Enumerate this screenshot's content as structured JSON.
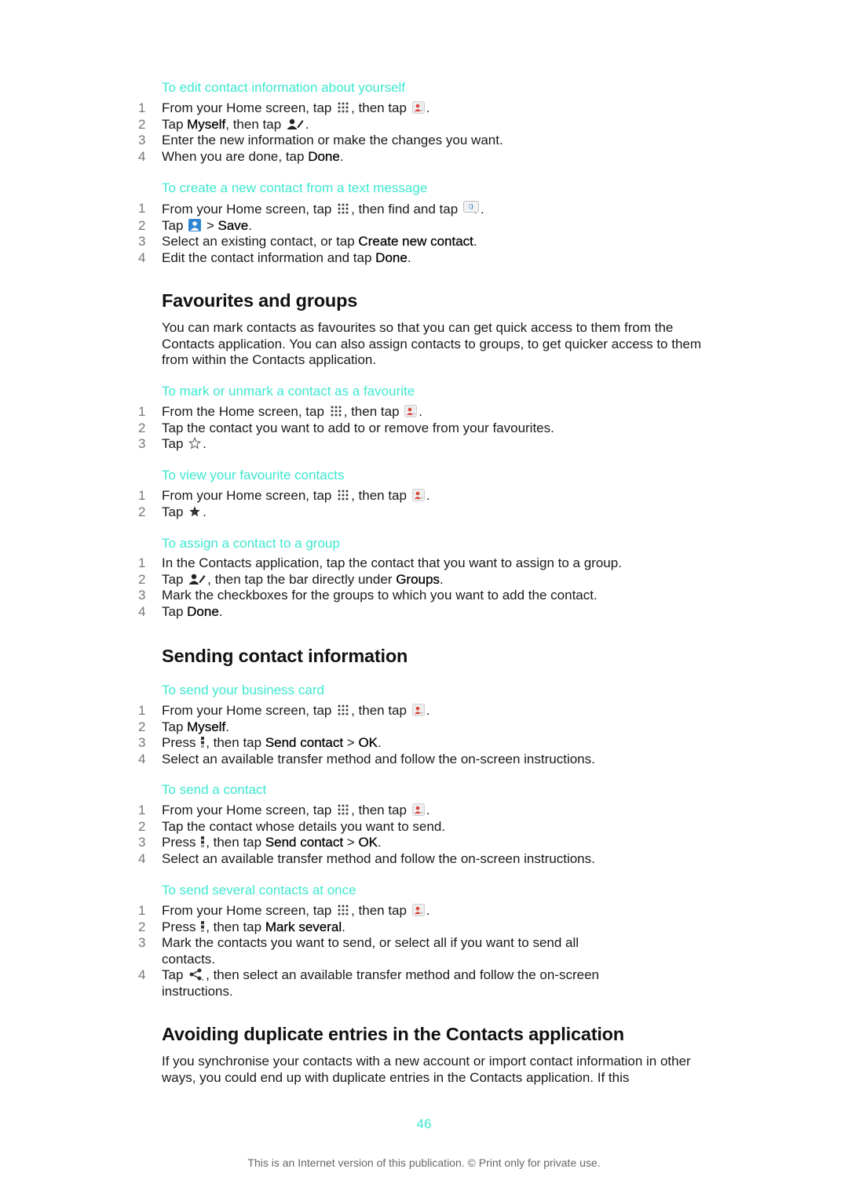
{
  "accent_color": "#3de8d0",
  "sections": {
    "edit_yourself": {
      "title": "To edit contact information about yourself",
      "steps": [
        {
          "n": "1",
          "a": "From your Home screen, tap ",
          "b": ", then tap ",
          "c": "."
        },
        {
          "n": "2",
          "a": "Tap ",
          "bold": "Myself",
          "b": ", then tap ",
          "c": "."
        },
        {
          "n": "3",
          "a": "Enter the new information or make the changes you want."
        },
        {
          "n": "4",
          "a": "When you are done, tap ",
          "bold": "Done",
          "c": "."
        }
      ]
    },
    "from_text": {
      "title": "To create a new contact from a text message",
      "steps": [
        {
          "n": "1",
          "a": "From your Home screen, tap ",
          "b": ", then find and tap ",
          "c": "."
        },
        {
          "n": "2",
          "a": "Tap ",
          "b": " > ",
          "bold": "Save",
          "c": "."
        },
        {
          "n": "3",
          "a": "Select an existing contact, or tap ",
          "bold": "Create new contact",
          "c": "."
        },
        {
          "n": "4",
          "a": "Edit the contact information and tap ",
          "bold": "Done",
          "c": "."
        }
      ]
    },
    "favourites": {
      "heading": "Favourites and groups",
      "intro": "You can mark contacts as favourites so that you can get quick access to them from the Contacts application. You can also assign contacts to groups, to get quicker access to them from within the Contacts application."
    },
    "mark_fav": {
      "title": "To mark or unmark a contact as a favourite",
      "steps": [
        {
          "n": "1",
          "a": "From the Home screen, tap ",
          "b": ", then tap ",
          "c": "."
        },
        {
          "n": "2",
          "a": "Tap the contact you want to add to or remove from your favourites."
        },
        {
          "n": "3",
          "a": "Tap ",
          "c": "."
        }
      ]
    },
    "view_fav": {
      "title": "To view your favourite contacts",
      "steps": [
        {
          "n": "1",
          "a": "From your Home screen, tap ",
          "b": ", then tap ",
          "c": "."
        },
        {
          "n": "2",
          "a": "Tap ",
          "c": "."
        }
      ]
    },
    "assign_group": {
      "title": "To assign a contact to a group",
      "steps": [
        {
          "n": "1",
          "a": "In the Contacts application, tap the contact that you want to assign to a group."
        },
        {
          "n": "2",
          "a": "Tap ",
          "b": ", then tap the bar directly under ",
          "bold": "Groups",
          "c": "."
        },
        {
          "n": "3",
          "a": "Mark the checkboxes for the groups to which you want to add the contact."
        },
        {
          "n": "4",
          "a": "Tap ",
          "bold": "Done",
          "c": "."
        }
      ]
    },
    "sending": {
      "heading": "Sending contact information"
    },
    "business_card": {
      "title": "To send your business card",
      "steps": [
        {
          "n": "1",
          "a": "From your Home screen, tap ",
          "b": ", then tap ",
          "c": "."
        },
        {
          "n": "2",
          "a": "Tap ",
          "bold": "Myself",
          "c": "."
        },
        {
          "n": "3",
          "a": "Press ",
          "b": ", then tap ",
          "bold": "Send contact",
          "gt": " > ",
          "bold2": "OK",
          "c": "."
        },
        {
          "n": "4",
          "a": "Select an available transfer method and follow the on-screen instructions."
        }
      ]
    },
    "send_contact": {
      "title": "To send a contact",
      "steps": [
        {
          "n": "1",
          "a": "From your Home screen, tap ",
          "b": ", then tap ",
          "c": "."
        },
        {
          "n": "2",
          "a": "Tap the contact whose details you want to send."
        },
        {
          "n": "3",
          "a": "Press ",
          "b": ", then tap ",
          "bold": "Send contact",
          "gt": " > ",
          "bold2": "OK",
          "c": "."
        },
        {
          "n": "4",
          "a": "Select an available transfer method and follow the on-screen instructions."
        }
      ]
    },
    "send_several": {
      "title": "To send several contacts at once",
      "steps": [
        {
          "n": "1",
          "a": "From your Home screen, tap ",
          "b": ", then tap ",
          "c": "."
        },
        {
          "n": "2",
          "a": "Press ",
          "b": ", then tap ",
          "bold": "Mark several",
          "c": "."
        },
        {
          "n": "3",
          "a": "Mark the contacts you want to send, or select all if you want to send all contacts."
        },
        {
          "n": "4",
          "a": "Tap ",
          "b": ", then select an available transfer method and follow the on-screen instructions."
        }
      ]
    },
    "duplicates": {
      "heading": "Avoiding duplicate entries in the Contacts application",
      "intro": "If you synchronise your contacts with a new account or import contact information in other ways, you could end up with duplicate entries in the Contacts application. If this"
    }
  },
  "icons": {
    "apps": "apps-grid-icon",
    "contacts": "contacts-app-icon",
    "edit_contact": "edit-contact-icon",
    "messaging": "messaging-app-icon",
    "add_contact": "add-contact-icon",
    "star_outline": "star-outline-icon",
    "star_filled": "star-filled-icon",
    "menu": "menu-icon",
    "share": "share-icon"
  },
  "page_number": "46",
  "footer": "This is an Internet version of this publication. © Print only for private use."
}
